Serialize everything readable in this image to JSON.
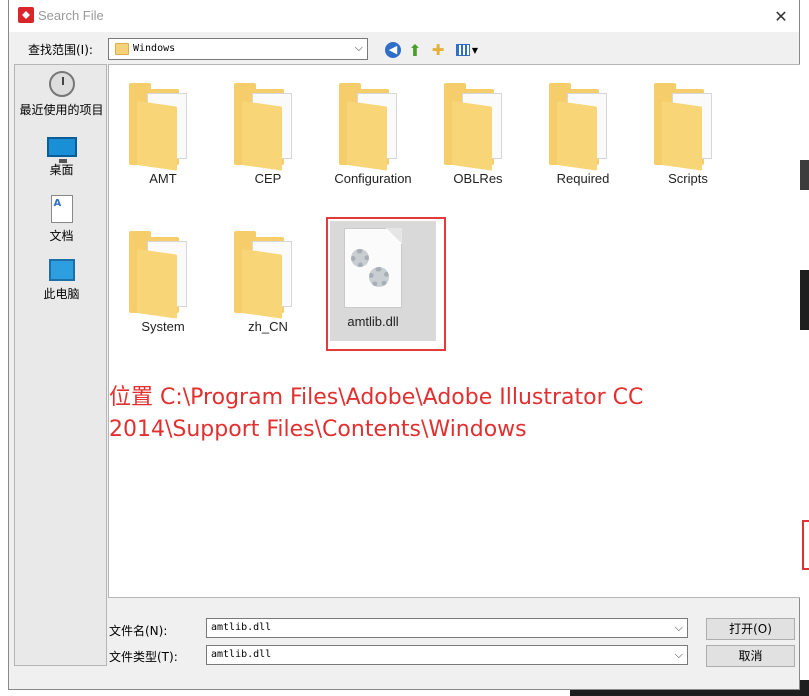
{
  "window": {
    "title": "Search File",
    "close_glyph": "✕"
  },
  "toolbar": {
    "look_in_label": "查找范围(I):",
    "look_in_value": "Windows",
    "dropdown_glyph": "⌵"
  },
  "places": [
    {
      "label": "最近使用的项目",
      "icon": "recent-icon"
    },
    {
      "label": "桌面",
      "icon": "desktop-icon"
    },
    {
      "label": "文档",
      "icon": "documents-icon"
    },
    {
      "label": "此电脑",
      "icon": "this-pc-icon"
    }
  ],
  "files": [
    {
      "name": "AMT",
      "type": "folder"
    },
    {
      "name": "CEP",
      "type": "folder"
    },
    {
      "name": "Configuration",
      "type": "folder"
    },
    {
      "name": "OBLRes",
      "type": "folder"
    },
    {
      "name": "Required",
      "type": "folder"
    },
    {
      "name": "Scripts",
      "type": "folder"
    },
    {
      "name": "System",
      "type": "folder"
    },
    {
      "name": "zh_CN",
      "type": "folder"
    },
    {
      "name": "amtlib.dll",
      "type": "file",
      "selected": true
    }
  ],
  "annotation": {
    "line1": "位置 C:\\Program Files\\Adobe\\Adobe Illustrator CC",
    "line2": "2014\\Support Files\\Contents\\Windows",
    "color": "#e23030"
  },
  "bottom": {
    "filename_label": "文件名(N):",
    "filename_value": "amtlib.dll",
    "filetype_label": "文件类型(T):",
    "filetype_value": "amtlib.dll",
    "open_button": "打开(O)",
    "cancel_button": "取消"
  }
}
